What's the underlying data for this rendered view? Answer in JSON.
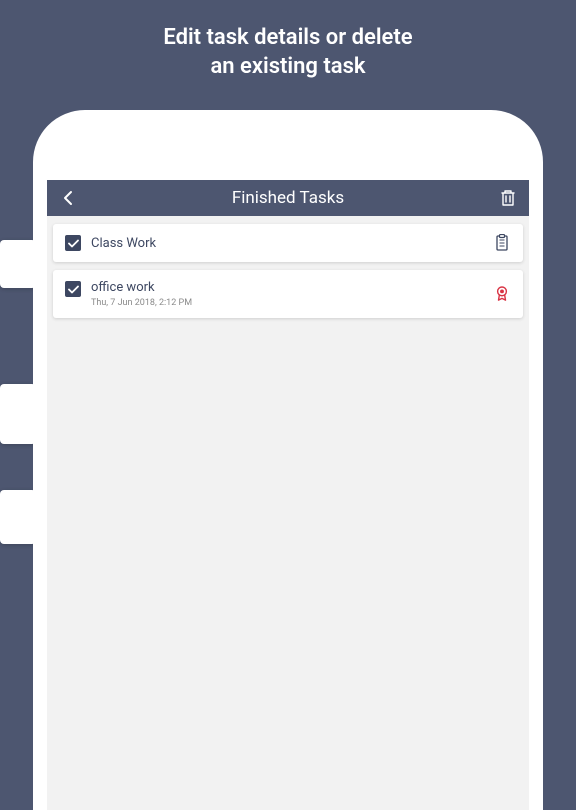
{
  "promo": {
    "line1": "Edit task details or delete",
    "line2": "an existing task"
  },
  "header": {
    "title": "Finished Tasks"
  },
  "tasks": [
    {
      "title": "Class Work",
      "meta": "",
      "icon": "clipboard"
    },
    {
      "title": "office work",
      "meta": "Thu, 7 Jun 2018, 2:12 PM",
      "icon": "badge"
    }
  ]
}
